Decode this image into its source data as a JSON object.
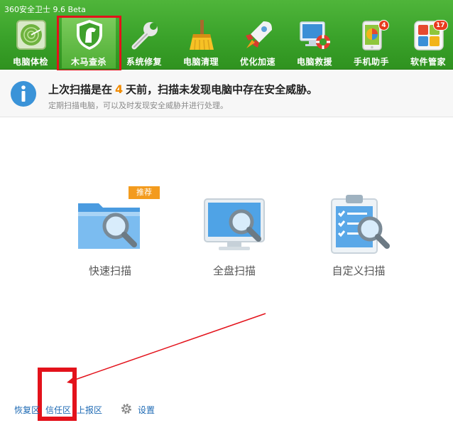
{
  "app": {
    "title": "360安全卫士 9.6 Beta"
  },
  "toolbar": {
    "items": [
      {
        "label": "电脑体检",
        "icon": "radar-scan-icon"
      },
      {
        "label": "木马查杀",
        "icon": "horse-shield-icon"
      },
      {
        "label": "系统修复",
        "icon": "wrench-icon"
      },
      {
        "label": "电脑清理",
        "icon": "broom-icon"
      },
      {
        "label": "优化加速",
        "icon": "rocket-icon"
      },
      {
        "label": "电脑救援",
        "icon": "monitor-lifebuoy-icon"
      },
      {
        "label": "手机助手",
        "icon": "phone-icon",
        "badge": "4"
      },
      {
        "label": "软件管家",
        "icon": "app-grid-icon",
        "badge": "17"
      }
    ],
    "active_index": 1
  },
  "info": {
    "main_prefix": "上次扫描是在",
    "days": "4",
    "main_suffix": "天前，扫描未发现电脑中存在安全威胁。",
    "sub": "定期扫描电脑，可以及时发现安全威胁并进行处理。"
  },
  "scan": {
    "recommend_badge": "推荐",
    "options": [
      {
        "label": "快速扫描",
        "icon": "folder-magnifier-icon"
      },
      {
        "label": "全盘扫描",
        "icon": "monitor-magnifier-icon"
      },
      {
        "label": "自定义扫描",
        "icon": "clipboard-magnifier-icon"
      }
    ]
  },
  "footer": {
    "links": [
      "恢复区",
      "信任区",
      "上报区"
    ],
    "settings_label": "设置"
  },
  "colors": {
    "toolbar_green": "#3aa22a",
    "annotation_red": "#e3121b",
    "link_blue": "#1e6ab4",
    "recommend_orange": "#f39b1e"
  }
}
